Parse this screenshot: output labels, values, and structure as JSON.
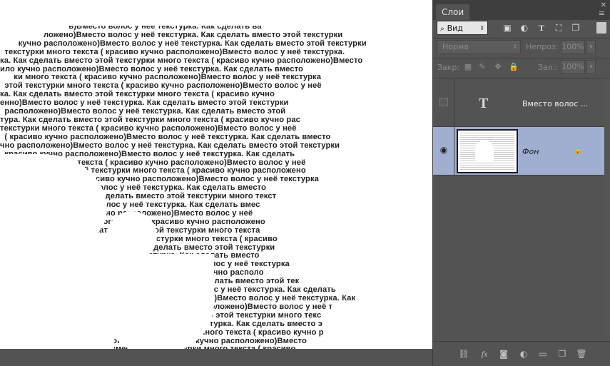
{
  "canvas": {
    "lines": [
      "                              в)Вместо волос у неё текстурка. Как сделать ва",
      "                   ложено)Вместо волос у неё текстурка. Как сделать вместо этой текстурки",
      "        кучно расположено)Вместо волос у неё текстурка. Как сделать вместо этой текстурки",
      "  текстурки много текста ( красиво кучно расположено)Вместо волос у неё текстурка.",
      "ка. Как сделать вместо этой текстурки много текста ( красиво кучно расположено)Вместо",
      "ило кучно расположено)Вместо волос у неё текстурка. Как сделать вместо",
      "      ки много текста ( красиво кучно расположено)Вместо волос у неё текстурка",
      "  этой текстурки много текста ( красиво кучно расположено)Вместо волос у неё",
      "ка. Как сделать вместо этой текстурки много текста ( красиво кучно",
      "енно)Вместо волос у неё текстурка. Как сделать вместо этой текстурки",
      "  расположено)Вместо волос у неё текстурка. Как сделать вместо этой",
      "тура. Как сделать вместо этой текстурки много текста ( красиво кучно рас",
      "текстурки много текста ( красиво кучно расположено)Вместо волос у неё",
      "  ( красиво кучно расположено)Вместо волос у неё текстурка. Как сделать вместо",
      "чно расположено)Вместо волос у неё текстурка. Как сделать вместо этой текстурки",
      "  красиво кучно расположено)Вместо волос у неё текстурка. Как сделать",
      "    текстурки много текста ( красиво кучно расположено)Вместо волос у неё",
      "  сделать вместо этой текстурки много текста ( красиво кучно расположено",
      "          много текста ( красиво кучно расположено)Вместо волос у неё текстурка",
      "                           Вместо волос у неё текстурка. Как сделать вместо",
      "                  текстурка. Как сделать вместо этой текстурки много текст",
      "                           )Вместо волос у неё текстурка. Как сделать вмес",
      "                         красиво кучно расположено)Вместо волос у неё",
      "                      текстурки много текста ( красиво кучно расположено",
      "                            Как сделать вместо этой текстурки много текста",
      "                         сделать вместо этой текстурки много текста ( красиво",
      "                             у неё текстурка. Как сделать вместо этой текстурки",
      "                        Вместо волос у неё текстурка. Как сделать вместо",
      "                       красиво кучно расположено)Вместо волос у неё текстурка",
      "                              текстурки много текста ( красиво кучно располо",
      "                          Вместо волос у неё текстурка. Как сделать вместо этой тек",
      "                    красиво кучно расположено)Вместо волос у неё текстурка. Как сделать",
      "                  много текста ( красиво кучно расположено)Вместо волос у неё текстурка. Как",
      "             текстурки много текста ( красиво кучно расположено)Вместо волос у неё т",
      "             то волос у неё текстурка. Как сделать вместо этой текстурки много текс",
      "             кучно расположено)Вместо волос у неё текстурка. Как сделать вместо э",
      "                   ы. Как сделать вместо этой текстурки много текста ( красиво кучно р",
      "                          текстурки много текста ( красиво кучно расположено)Вместо",
      "                                 сделать вместо этой текстурки много текста ( красиво"
    ]
  },
  "panel": {
    "tab_label": "Слои",
    "close_glyph": "✕",
    "menu_glyph": "≡",
    "filter": {
      "kind_label": "Вид",
      "search_glyph": "⌕",
      "updown_glyph": "⇕"
    },
    "blend": {
      "mode": "Норма",
      "opacity_label": "Непроз:",
      "opacity_value": "100%"
    },
    "locks": {
      "label": "Закр:",
      "fill_label": "Зал.:",
      "fill_value": "100%"
    },
    "layers": [
      {
        "name": "Вместо волос ...",
        "type_glyph": "T",
        "visible": false
      },
      {
        "name": "Фон",
        "visible": true,
        "locked": true
      }
    ],
    "eye_glyph": "◉",
    "lock_glyph": "🔒",
    "dropdown_glyph": "▾"
  },
  "footer": {
    "icons": [
      "link-icon",
      "fx-icon",
      "mask-icon",
      "adjustment-icon",
      "folder-icon",
      "new-layer-icon",
      "trash-icon"
    ],
    "glyphs": [
      "⛓",
      "fx",
      "◙",
      "◐",
      "▭",
      "❐",
      "🗑"
    ]
  }
}
